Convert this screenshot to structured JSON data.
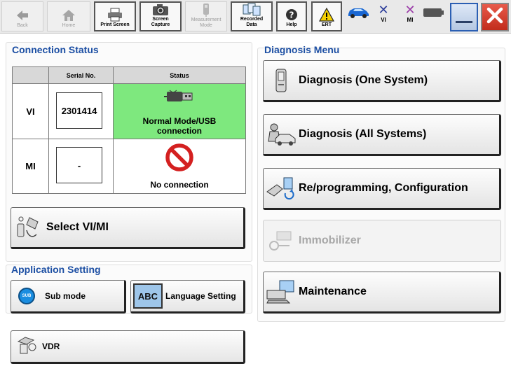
{
  "toolbar": {
    "back": "Back",
    "home": "Home",
    "print_screen": "Print Screen",
    "screen_capture": [
      "Screen",
      "Capture"
    ],
    "measurement_mode": [
      "Measurement",
      "Mode"
    ],
    "recorded_data": [
      "Recorded",
      "Data"
    ],
    "help": "Help",
    "ert": "ERT",
    "vi": "VI",
    "mi": "MI"
  },
  "connection": {
    "title": "Connection Status",
    "col_serial": "Serial No.",
    "col_status": "Status",
    "vi_label": "VI",
    "vi_serial": "2301414",
    "vi_status": [
      "Normal Mode/USB",
      "connection"
    ],
    "mi_label": "MI",
    "mi_serial": "-",
    "mi_status": "No connection",
    "select_button": "Select VI/MI"
  },
  "application": {
    "title": "Application Setting",
    "sub_mode": "Sub mode",
    "sub_icon_text": "SUB",
    "language": "Language Setting",
    "abc_icon_text": "ABC",
    "vdr": "VDR"
  },
  "diagnosis": {
    "title": "Diagnosis Menu",
    "one_system": "Diagnosis (One System)",
    "all_systems": "Diagnosis (All Systems)",
    "reprogramming": "Re/programming, Configuration",
    "immobilizer": "Immobilizer",
    "maintenance": "Maintenance"
  },
  "colors": {
    "title_blue": "#1b4ea3",
    "status_green": "#7ee87e",
    "no_conn_red": "#d42020"
  }
}
